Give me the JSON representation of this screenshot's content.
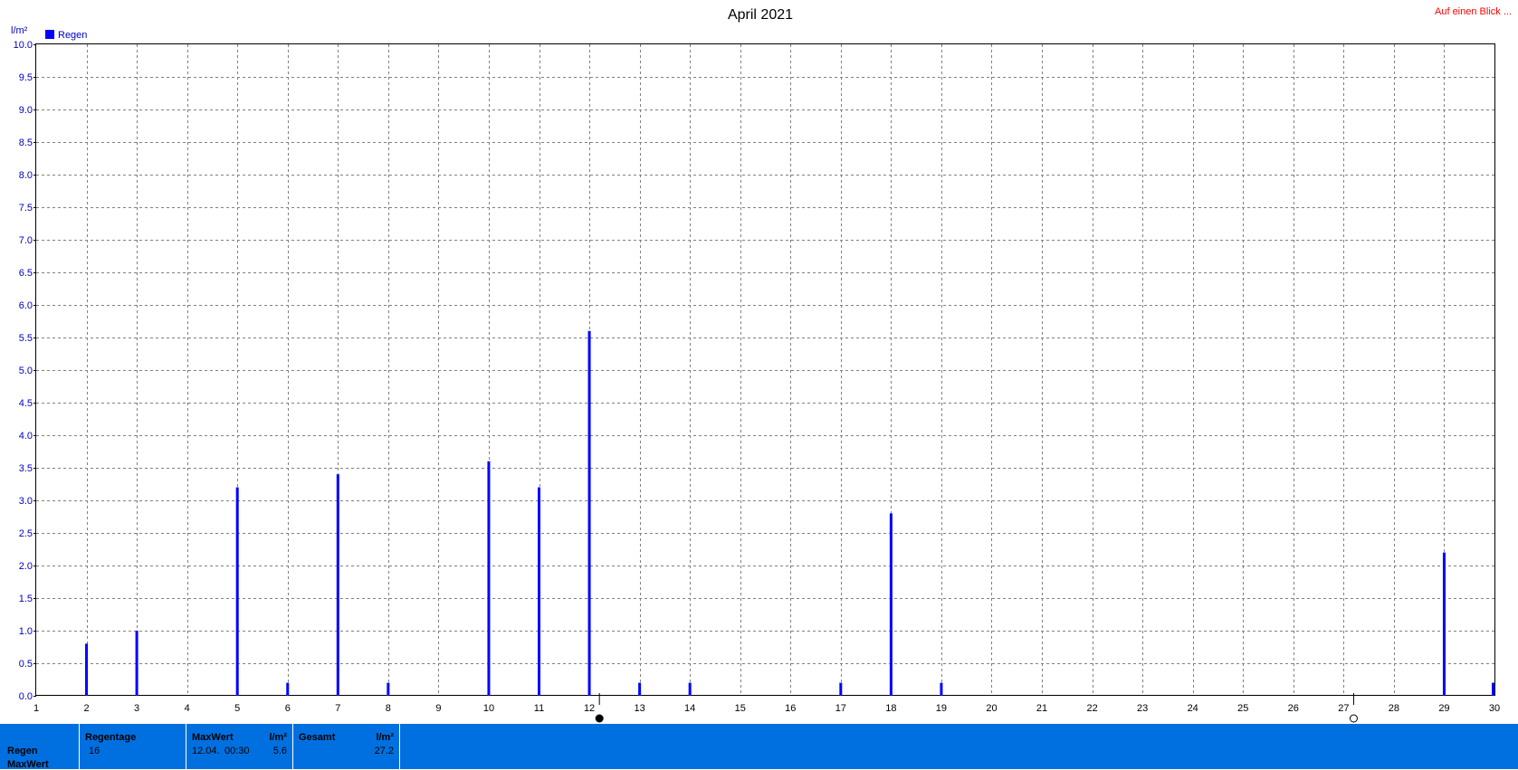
{
  "header": {
    "title": "April 2021",
    "link": "Auf einen Blick ..."
  },
  "legend": {
    "color": "#0000ff",
    "label": "Regen"
  },
  "colors": {
    "bar": "#0000ff",
    "axis_text": "#0000c0",
    "grid": "#808080",
    "stats_bg": "#0070e0",
    "link": "#ff0000"
  },
  "chart_data": {
    "type": "bar",
    "title": "April 2021",
    "ylabel": "l/m²",
    "xlabel": "",
    "ylim": [
      0,
      10
    ],
    "yticks": [
      "0.0",
      "0.5",
      "1.0",
      "1.5",
      "2.0",
      "2.5",
      "3.0",
      "3.5",
      "4.0",
      "4.5",
      "5.0",
      "5.5",
      "6.0",
      "6.5",
      "7.0",
      "7.5",
      "8.0",
      "8.5",
      "9.0",
      "9.5",
      "10.0"
    ],
    "xlim": [
      1,
      30
    ],
    "xticks": [
      "1",
      "2",
      "3",
      "4",
      "5",
      "6",
      "7",
      "8",
      "9",
      "10",
      "11",
      "12",
      "13",
      "14",
      "15",
      "16",
      "17",
      "18",
      "19",
      "20",
      "21",
      "22",
      "23",
      "24",
      "25",
      "26",
      "27",
      "28",
      "29",
      "30"
    ],
    "grid": true,
    "legend_position": "top-left",
    "series": [
      {
        "name": "Regen",
        "x": [
          2,
          3,
          5,
          6,
          7,
          8,
          10,
          11,
          12,
          13,
          14,
          17,
          18,
          19,
          29,
          30
        ],
        "values": [
          0.8,
          1.0,
          3.2,
          0.2,
          3.4,
          0.2,
          3.6,
          3.2,
          5.6,
          0.2,
          0.2,
          0.2,
          2.8,
          0.2,
          2.2,
          0.2
        ]
      }
    ],
    "moon_markers": [
      {
        "day": 12.2,
        "phase": "new-moon"
      },
      {
        "day": 27.2,
        "phase": "full-moon"
      }
    ]
  },
  "stats": {
    "row_labels": [
      "Regen",
      "MaxWert"
    ],
    "regentage": {
      "header": "Regentage",
      "value": "16"
    },
    "maxwert": {
      "header": "MaxWert",
      "unit": "l/m²",
      "date": "12.04.",
      "time": "00:30",
      "value": "5.6"
    },
    "gesamt": {
      "header": "Gesamt",
      "unit": "l/m²",
      "value": "27.2"
    }
  }
}
